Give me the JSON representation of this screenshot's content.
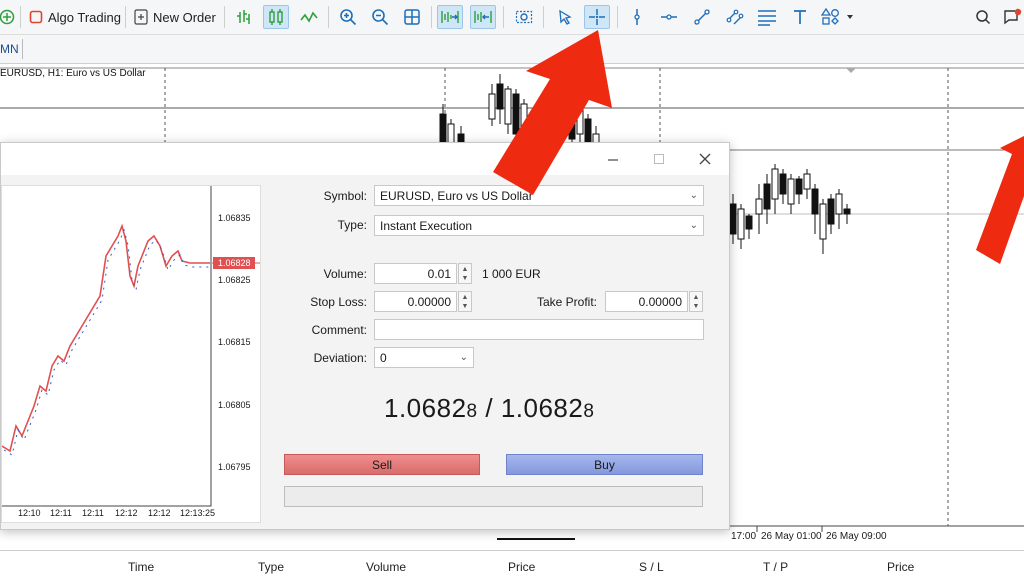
{
  "toolbar": {
    "algo_trading_label": "Algo Trading",
    "new_order_label": "New Order",
    "accent": "#1e88e5"
  },
  "tabbar": {
    "active_tab": "MN"
  },
  "chart": {
    "title": "EURUSD, H1:  Euro vs US Dollar",
    "time_labels": [
      "17:00",
      "26 May 01:00",
      "26 May 09:00"
    ]
  },
  "bottom": {
    "columns": [
      "Time",
      "Type",
      "Volume",
      "Price",
      "S / L",
      "T / P",
      "Price"
    ]
  },
  "dialog": {
    "symbol_label": "Symbol:",
    "symbol_value": "EURUSD, Euro vs US Dollar",
    "type_label": "Type:",
    "type_value": "Instant Execution",
    "volume_label": "Volume:",
    "volume_value": "0.01",
    "volume_units": "1 000 EUR",
    "stop_loss_label": "Stop Loss:",
    "stop_loss_value": "0.00000",
    "take_profit_label": "Take Profit:",
    "take_profit_value": "0.00000",
    "comment_label": "Comment:",
    "comment_value": "",
    "deviation_label": "Deviation:",
    "deviation_value": "0",
    "bid_main": "1.0682",
    "bid_small": "8",
    "separator": "/",
    "ask_main": "1.0682",
    "ask_small": "8",
    "sell_label": "Sell",
    "buy_label": "Buy"
  },
  "mini_chart": {
    "price_labels": [
      "1.06835",
      "1.06825",
      "1.06815",
      "1.06805",
      "1.06795"
    ],
    "current_price": "1.06828",
    "time_labels": [
      "12:10",
      "12:11",
      "12:11",
      "12:12",
      "12:12",
      "12:13:25"
    ],
    "sell_color": "#e05050",
    "buy_color": "#2f5fd0"
  }
}
